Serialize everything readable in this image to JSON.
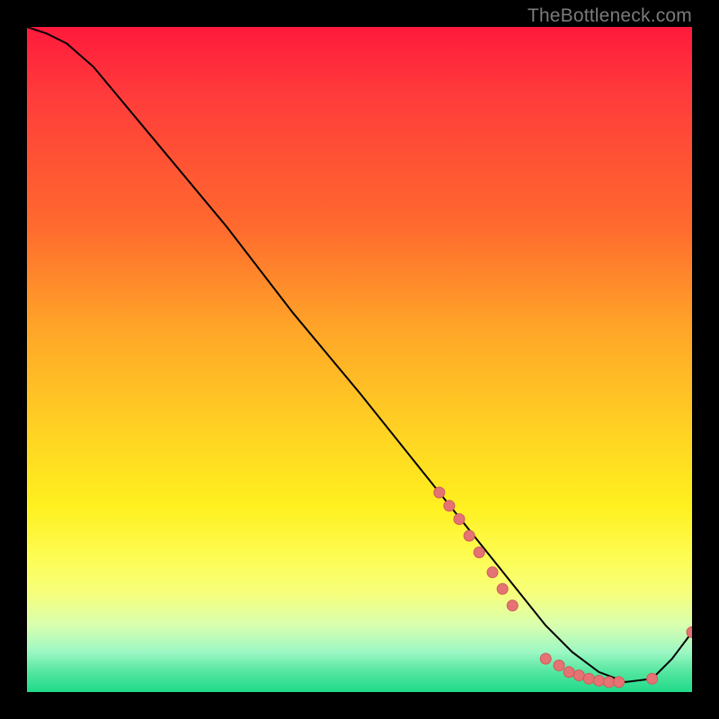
{
  "watermark": "TheBottleneck.com",
  "chart_data": {
    "type": "line",
    "title": "",
    "xlabel": "",
    "ylabel": "",
    "xlim": [
      0,
      100
    ],
    "ylim": [
      0,
      100
    ],
    "series": [
      {
        "name": "curve",
        "x": [
          0,
          3,
          6,
          10,
          15,
          20,
          30,
          40,
          50,
          58,
          62,
          66,
          70,
          74,
          78,
          82,
          86,
          90,
          94,
          97,
          100
        ],
        "y": [
          100,
          99,
          97.5,
          94,
          88,
          82,
          70,
          57,
          45,
          35,
          30,
          25,
          20,
          15,
          10,
          6,
          3,
          1.5,
          2,
          5,
          9
        ]
      }
    ],
    "markers": [
      {
        "x": 62,
        "y": 30
      },
      {
        "x": 63.5,
        "y": 28
      },
      {
        "x": 65,
        "y": 26
      },
      {
        "x": 66.5,
        "y": 23.5
      },
      {
        "x": 68,
        "y": 21
      },
      {
        "x": 70,
        "y": 18
      },
      {
        "x": 71.5,
        "y": 15.5
      },
      {
        "x": 73,
        "y": 13
      },
      {
        "x": 78,
        "y": 5
      },
      {
        "x": 80,
        "y": 4
      },
      {
        "x": 81.5,
        "y": 3
      },
      {
        "x": 83,
        "y": 2.5
      },
      {
        "x": 84.5,
        "y": 2
      },
      {
        "x": 86,
        "y": 1.7
      },
      {
        "x": 87.5,
        "y": 1.5
      },
      {
        "x": 89,
        "y": 1.5
      },
      {
        "x": 94,
        "y": 2
      },
      {
        "x": 100,
        "y": 9
      }
    ],
    "marker_radius": 6,
    "marker_color": "#e57373"
  }
}
